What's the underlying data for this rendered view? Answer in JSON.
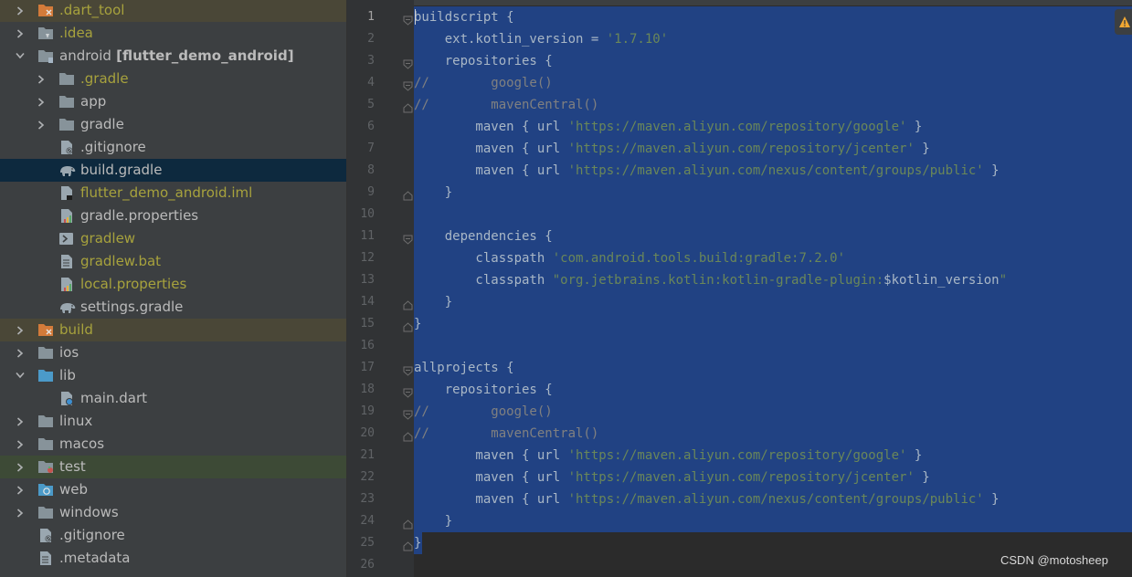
{
  "tree": {
    "rows": [
      {
        "label": ".dart_tool",
        "color": "yellow",
        "bg": "olive",
        "indent": 0,
        "arrow": "right",
        "icon": "folder-orange-icon"
      },
      {
        "label": ".idea",
        "color": "yellow",
        "bg": "",
        "indent": 0,
        "arrow": "right",
        "icon": "folder-idea-icon"
      },
      {
        "label": "android",
        "suffix": " [flutter_demo_android]",
        "color": "default",
        "bg": "",
        "indent": 0,
        "arrow": "down",
        "icon": "folder-module-icon"
      },
      {
        "label": ".gradle",
        "color": "yellow",
        "bg": "",
        "indent": 1,
        "arrow": "right",
        "icon": "folder-icon"
      },
      {
        "label": "app",
        "color": "default",
        "bg": "",
        "indent": 1,
        "arrow": "right",
        "icon": "folder-icon"
      },
      {
        "label": "gradle",
        "color": "default",
        "bg": "",
        "indent": 1,
        "arrow": "right",
        "icon": "folder-icon"
      },
      {
        "label": ".gitignore",
        "color": "default",
        "bg": "",
        "indent": 1,
        "arrow": "",
        "icon": "gitignore-file-icon"
      },
      {
        "label": "build.gradle",
        "color": "default",
        "bg": "selected",
        "indent": 1,
        "arrow": "",
        "icon": "gradle-elephant-icon"
      },
      {
        "label": "flutter_demo_android.iml",
        "color": "yellow",
        "bg": "",
        "indent": 1,
        "arrow": "",
        "icon": "iml-file-icon"
      },
      {
        "label": "gradle.properties",
        "color": "default",
        "bg": "",
        "indent": 1,
        "arrow": "",
        "icon": "properties-file-icon"
      },
      {
        "label": "gradlew",
        "color": "yellow",
        "bg": "",
        "indent": 1,
        "arrow": "",
        "icon": "shell-script-icon"
      },
      {
        "label": "gradlew.bat",
        "color": "yellow",
        "bg": "",
        "indent": 1,
        "arrow": "",
        "icon": "text-file-icon"
      },
      {
        "label": "local.properties",
        "color": "yellow",
        "bg": "",
        "indent": 1,
        "arrow": "",
        "icon": "properties-file-icon"
      },
      {
        "label": "settings.gradle",
        "color": "default",
        "bg": "",
        "indent": 1,
        "arrow": "",
        "icon": "gradle-elephant-icon"
      },
      {
        "label": "build",
        "color": "yellow",
        "bg": "olive",
        "indent": 0,
        "arrow": "right",
        "icon": "folder-orange-icon"
      },
      {
        "label": "ios",
        "color": "default",
        "bg": "",
        "indent": 0,
        "arrow": "right",
        "icon": "folder-icon"
      },
      {
        "label": "lib",
        "color": "default",
        "bg": "",
        "indent": 0,
        "arrow": "down",
        "icon": "folder-source-icon"
      },
      {
        "label": "main.dart",
        "color": "default",
        "bg": "",
        "indent": 1,
        "arrow": "",
        "icon": "dart-file-icon"
      },
      {
        "label": "linux",
        "color": "default",
        "bg": "",
        "indent": 0,
        "arrow": "right",
        "icon": "folder-icon"
      },
      {
        "label": "macos",
        "color": "default",
        "bg": "",
        "indent": 0,
        "arrow": "right",
        "icon": "folder-icon"
      },
      {
        "label": "test",
        "color": "default",
        "bg": "green",
        "indent": 0,
        "arrow": "right",
        "icon": "folder-test-icon"
      },
      {
        "label": "web",
        "color": "default",
        "bg": "",
        "indent": 0,
        "arrow": "right",
        "icon": "folder-web-icon"
      },
      {
        "label": "windows",
        "color": "default",
        "bg": "",
        "indent": 0,
        "arrow": "right",
        "icon": "folder-icon"
      },
      {
        "label": ".gitignore",
        "color": "default",
        "bg": "",
        "indent": 0,
        "arrow": "",
        "icon": "gitignore-file-icon"
      },
      {
        "label": ".metadata",
        "color": "default",
        "bg": "",
        "indent": 0,
        "arrow": "",
        "icon": "text-file-icon"
      }
    ]
  },
  "editor": {
    "current_line": 1,
    "lines": [
      {
        "n": "1",
        "fold": "start",
        "parts": [
          [
            "t",
            "buildscript {"
          ]
        ]
      },
      {
        "n": "2",
        "fold": "",
        "parts": [
          [
            "t",
            "    ext.kotlin_version = "
          ],
          [
            "s",
            "'1.7.10'"
          ]
        ]
      },
      {
        "n": "3",
        "fold": "start",
        "parts": [
          [
            "t",
            "    repositories {"
          ]
        ]
      },
      {
        "n": "4",
        "fold": "start",
        "parts": [
          [
            "c",
            "//        google()"
          ]
        ]
      },
      {
        "n": "5",
        "fold": "end",
        "parts": [
          [
            "c",
            "//        mavenCentral()"
          ]
        ]
      },
      {
        "n": "6",
        "fold": "",
        "parts": [
          [
            "t",
            "        maven { url "
          ],
          [
            "s",
            "'https://maven.aliyun.com/repository/google'"
          ],
          [
            "t",
            " }"
          ]
        ]
      },
      {
        "n": "7",
        "fold": "",
        "parts": [
          [
            "t",
            "        maven { url "
          ],
          [
            "s",
            "'https://maven.aliyun.com/repository/jcenter'"
          ],
          [
            "t",
            " }"
          ]
        ]
      },
      {
        "n": "8",
        "fold": "",
        "parts": [
          [
            "t",
            "        maven { url "
          ],
          [
            "s",
            "'https://maven.aliyun.com/nexus/content/groups/public'"
          ],
          [
            "t",
            " }"
          ]
        ]
      },
      {
        "n": "9",
        "fold": "end",
        "parts": [
          [
            "t",
            "    }"
          ]
        ]
      },
      {
        "n": "10",
        "fold": "",
        "parts": [
          [
            "t",
            ""
          ]
        ]
      },
      {
        "n": "11",
        "fold": "start",
        "parts": [
          [
            "t",
            "    dependencies {"
          ]
        ]
      },
      {
        "n": "12",
        "fold": "",
        "parts": [
          [
            "t",
            "        classpath "
          ],
          [
            "s",
            "'com.android.tools.build:gradle:7.2.0'"
          ]
        ]
      },
      {
        "n": "13",
        "fold": "",
        "parts": [
          [
            "t",
            "        classpath "
          ],
          [
            "s",
            "\"org.jetbrains.kotlin:kotlin-gradle-plugin:"
          ],
          [
            "t",
            "$kotlin_version"
          ],
          [
            "s",
            "\""
          ]
        ]
      },
      {
        "n": "14",
        "fold": "end",
        "parts": [
          [
            "t",
            "    }"
          ]
        ]
      },
      {
        "n": "15",
        "fold": "end",
        "parts": [
          [
            "t",
            "}"
          ]
        ]
      },
      {
        "n": "16",
        "fold": "",
        "parts": [
          [
            "t",
            ""
          ]
        ]
      },
      {
        "n": "17",
        "fold": "start",
        "parts": [
          [
            "t",
            "allprojects {"
          ]
        ]
      },
      {
        "n": "18",
        "fold": "start",
        "parts": [
          [
            "t",
            "    repositories {"
          ]
        ]
      },
      {
        "n": "19",
        "fold": "start",
        "parts": [
          [
            "c",
            "//        google()"
          ]
        ]
      },
      {
        "n": "20",
        "fold": "end",
        "parts": [
          [
            "c",
            "//        mavenCentral()"
          ]
        ]
      },
      {
        "n": "21",
        "fold": "",
        "parts": [
          [
            "t",
            "        maven { url "
          ],
          [
            "s",
            "'https://maven.aliyun.com/repository/google'"
          ],
          [
            "t",
            " }"
          ]
        ]
      },
      {
        "n": "22",
        "fold": "",
        "parts": [
          [
            "t",
            "        maven { url "
          ],
          [
            "s",
            "'https://maven.aliyun.com/repository/jcenter'"
          ],
          [
            "t",
            " }"
          ]
        ]
      },
      {
        "n": "23",
        "fold": "",
        "parts": [
          [
            "t",
            "        maven { url "
          ],
          [
            "s",
            "'https://maven.aliyun.com/nexus/content/groups/public'"
          ],
          [
            "t",
            " }"
          ]
        ]
      },
      {
        "n": "24",
        "fold": "end",
        "parts": [
          [
            "t",
            "    }"
          ]
        ]
      },
      {
        "n": "25",
        "fold": "end",
        "parts": [
          [
            "t",
            "}"
          ]
        ]
      },
      {
        "n": "26",
        "fold": "",
        "parts": [
          [
            "t",
            ""
          ]
        ]
      }
    ]
  },
  "colors": {
    "selection": "#214283",
    "string": "#6a8759",
    "comment": "#808080",
    "text": "#a9b7c6",
    "tree_selected": "#0d293e",
    "tree_modified": "#a7a23d"
  },
  "warning_icon": "warning-icon",
  "watermark": "CSDN @motosheep"
}
